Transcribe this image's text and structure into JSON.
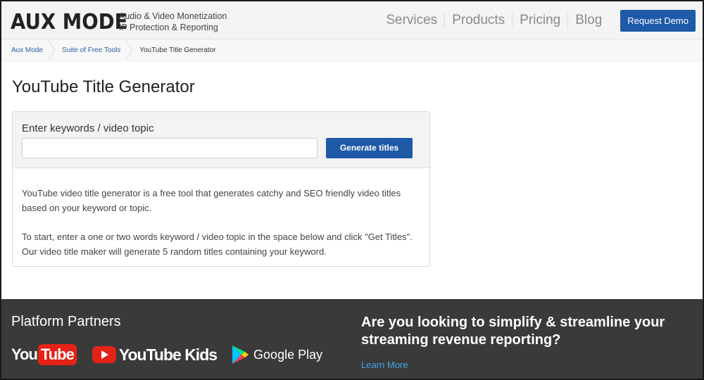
{
  "header": {
    "logo": "AUX MODE",
    "tagline_line1": "Audio & Video Monetization",
    "tagline_line2": "IP Protection & Reporting",
    "nav": [
      "Services",
      "Products",
      "Pricing",
      "Blog"
    ],
    "demo_button": "Request Demo",
    "accent_color": "#1e5aa8"
  },
  "breadcrumb": [
    "Aux Mode",
    "Suite of Free Tools",
    "YouTube Title Generator"
  ],
  "main": {
    "title": "YouTube Title Generator",
    "field_label": "Enter keywords / video topic",
    "input_value": "",
    "generate_button": "Generate titles",
    "description_1": "YouTube video title generator is a free tool that generates catchy and SEO friendly video titles based on your keyword or topic.",
    "description_2": "To start, enter a one or two words keyword / video topic in the space below and click \"Get Titles\". Our video title maker will generate 5 random titles containing your keyword."
  },
  "footer": {
    "partners_title": "Platform Partners",
    "partners": {
      "youtube_you": "You",
      "youtube_tube": "Tube",
      "youtube_kids": "YouTube Kids",
      "google_play": "Google Play"
    },
    "cta_title": "Are you looking to simplify & streamline your streaming revenue reporting?",
    "learn_more": "Learn More",
    "background_color": "#3a3a3a"
  }
}
